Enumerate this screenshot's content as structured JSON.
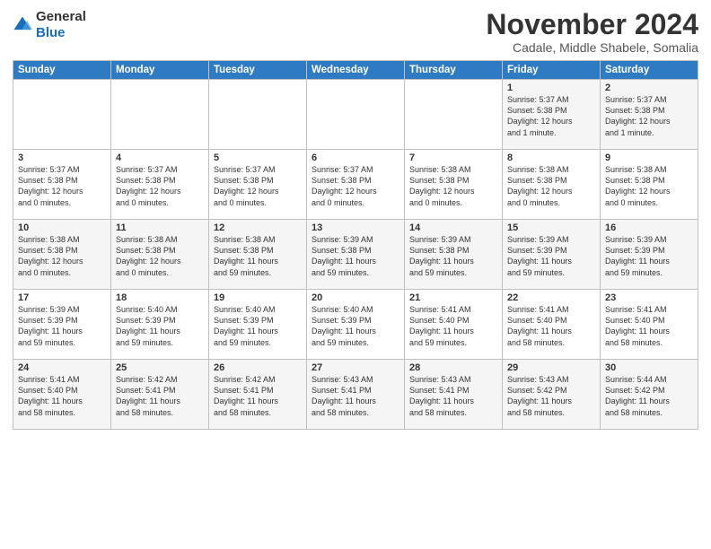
{
  "logo": {
    "general": "General",
    "blue": "Blue"
  },
  "header": {
    "month": "November 2024",
    "location": "Cadale, Middle Shabele, Somalia"
  },
  "weekdays": [
    "Sunday",
    "Monday",
    "Tuesday",
    "Wednesday",
    "Thursday",
    "Friday",
    "Saturday"
  ],
  "weeks": [
    [
      {
        "day": "",
        "info": ""
      },
      {
        "day": "",
        "info": ""
      },
      {
        "day": "",
        "info": ""
      },
      {
        "day": "",
        "info": ""
      },
      {
        "day": "",
        "info": ""
      },
      {
        "day": "1",
        "info": "Sunrise: 5:37 AM\nSunset: 5:38 PM\nDaylight: 12 hours\nand 1 minute."
      },
      {
        "day": "2",
        "info": "Sunrise: 5:37 AM\nSunset: 5:38 PM\nDaylight: 12 hours\nand 1 minute."
      }
    ],
    [
      {
        "day": "3",
        "info": "Sunrise: 5:37 AM\nSunset: 5:38 PM\nDaylight: 12 hours\nand 0 minutes."
      },
      {
        "day": "4",
        "info": "Sunrise: 5:37 AM\nSunset: 5:38 PM\nDaylight: 12 hours\nand 0 minutes."
      },
      {
        "day": "5",
        "info": "Sunrise: 5:37 AM\nSunset: 5:38 PM\nDaylight: 12 hours\nand 0 minutes."
      },
      {
        "day": "6",
        "info": "Sunrise: 5:37 AM\nSunset: 5:38 PM\nDaylight: 12 hours\nand 0 minutes."
      },
      {
        "day": "7",
        "info": "Sunrise: 5:38 AM\nSunset: 5:38 PM\nDaylight: 12 hours\nand 0 minutes."
      },
      {
        "day": "8",
        "info": "Sunrise: 5:38 AM\nSunset: 5:38 PM\nDaylight: 12 hours\nand 0 minutes."
      },
      {
        "day": "9",
        "info": "Sunrise: 5:38 AM\nSunset: 5:38 PM\nDaylight: 12 hours\nand 0 minutes."
      }
    ],
    [
      {
        "day": "10",
        "info": "Sunrise: 5:38 AM\nSunset: 5:38 PM\nDaylight: 12 hours\nand 0 minutes."
      },
      {
        "day": "11",
        "info": "Sunrise: 5:38 AM\nSunset: 5:38 PM\nDaylight: 12 hours\nand 0 minutes."
      },
      {
        "day": "12",
        "info": "Sunrise: 5:38 AM\nSunset: 5:38 PM\nDaylight: 11 hours\nand 59 minutes."
      },
      {
        "day": "13",
        "info": "Sunrise: 5:39 AM\nSunset: 5:38 PM\nDaylight: 11 hours\nand 59 minutes."
      },
      {
        "day": "14",
        "info": "Sunrise: 5:39 AM\nSunset: 5:38 PM\nDaylight: 11 hours\nand 59 minutes."
      },
      {
        "day": "15",
        "info": "Sunrise: 5:39 AM\nSunset: 5:39 PM\nDaylight: 11 hours\nand 59 minutes."
      },
      {
        "day": "16",
        "info": "Sunrise: 5:39 AM\nSunset: 5:39 PM\nDaylight: 11 hours\nand 59 minutes."
      }
    ],
    [
      {
        "day": "17",
        "info": "Sunrise: 5:39 AM\nSunset: 5:39 PM\nDaylight: 11 hours\nand 59 minutes."
      },
      {
        "day": "18",
        "info": "Sunrise: 5:40 AM\nSunset: 5:39 PM\nDaylight: 11 hours\nand 59 minutes."
      },
      {
        "day": "19",
        "info": "Sunrise: 5:40 AM\nSunset: 5:39 PM\nDaylight: 11 hours\nand 59 minutes."
      },
      {
        "day": "20",
        "info": "Sunrise: 5:40 AM\nSunset: 5:39 PM\nDaylight: 11 hours\nand 59 minutes."
      },
      {
        "day": "21",
        "info": "Sunrise: 5:41 AM\nSunset: 5:40 PM\nDaylight: 11 hours\nand 59 minutes."
      },
      {
        "day": "22",
        "info": "Sunrise: 5:41 AM\nSunset: 5:40 PM\nDaylight: 11 hours\nand 58 minutes."
      },
      {
        "day": "23",
        "info": "Sunrise: 5:41 AM\nSunset: 5:40 PM\nDaylight: 11 hours\nand 58 minutes."
      }
    ],
    [
      {
        "day": "24",
        "info": "Sunrise: 5:41 AM\nSunset: 5:40 PM\nDaylight: 11 hours\nand 58 minutes."
      },
      {
        "day": "25",
        "info": "Sunrise: 5:42 AM\nSunset: 5:41 PM\nDaylight: 11 hours\nand 58 minutes."
      },
      {
        "day": "26",
        "info": "Sunrise: 5:42 AM\nSunset: 5:41 PM\nDaylight: 11 hours\nand 58 minutes."
      },
      {
        "day": "27",
        "info": "Sunrise: 5:43 AM\nSunset: 5:41 PM\nDaylight: 11 hours\nand 58 minutes."
      },
      {
        "day": "28",
        "info": "Sunrise: 5:43 AM\nSunset: 5:41 PM\nDaylight: 11 hours\nand 58 minutes."
      },
      {
        "day": "29",
        "info": "Sunrise: 5:43 AM\nSunset: 5:42 PM\nDaylight: 11 hours\nand 58 minutes."
      },
      {
        "day": "30",
        "info": "Sunrise: 5:44 AM\nSunset: 5:42 PM\nDaylight: 11 hours\nand 58 minutes."
      }
    ]
  ]
}
